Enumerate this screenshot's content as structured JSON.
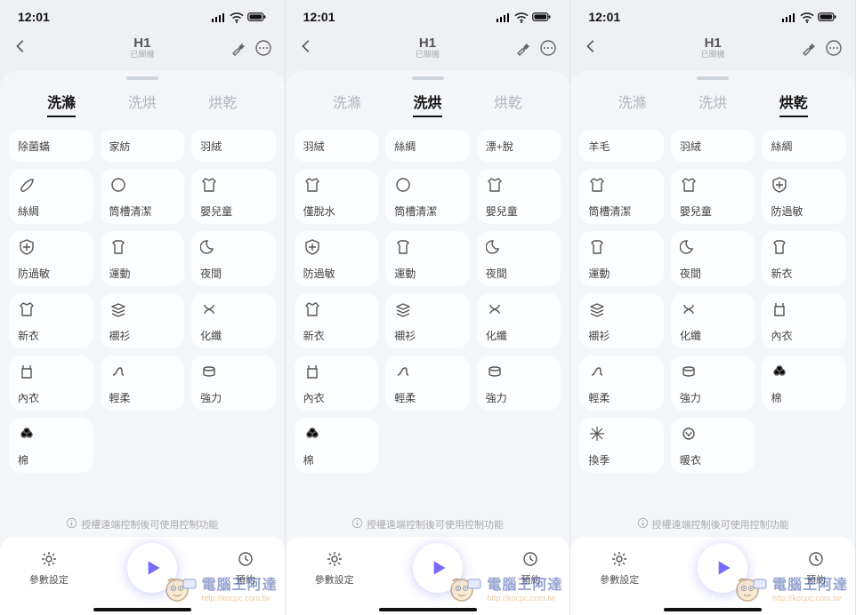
{
  "status": {
    "time": "12:01"
  },
  "header": {
    "title": "H1",
    "subtitle": "已關機"
  },
  "tabs": {
    "wash": "洗滌",
    "washDry": "洗烘",
    "dry": "烘乾"
  },
  "phone1": {
    "activeTab": 0,
    "row0": [
      "除菌蟎",
      "家紡",
      "羽絨"
    ],
    "opts": [
      {
        "icon": "silk",
        "label": "絲綢"
      },
      {
        "icon": "moon",
        "label": "筒槽清潔"
      },
      {
        "icon": "shirt",
        "label": "嬰兒童"
      },
      {
        "icon": "shield",
        "label": "防過敏"
      },
      {
        "icon": "tee",
        "label": "運動"
      },
      {
        "icon": "night",
        "label": "夜間"
      },
      {
        "icon": "shirt",
        "label": "新衣"
      },
      {
        "icon": "layers",
        "label": "襯衫"
      },
      {
        "icon": "fiber",
        "label": "化纖"
      },
      {
        "icon": "tank",
        "label": "內衣"
      },
      {
        "icon": "soft",
        "label": "輕柔"
      },
      {
        "icon": "strong",
        "label": "強力"
      },
      {
        "icon": "cotton",
        "label": "棉"
      }
    ]
  },
  "phone2": {
    "activeTab": 1,
    "row0": [
      "羽絨",
      "絲綢",
      "漂+脫"
    ],
    "opts": [
      {
        "icon": "shirt",
        "label": "僅脫水"
      },
      {
        "icon": "moon",
        "label": "筒槽清潔"
      },
      {
        "icon": "shirt",
        "label": "嬰兒童"
      },
      {
        "icon": "shield",
        "label": "防過敏"
      },
      {
        "icon": "tee",
        "label": "運動"
      },
      {
        "icon": "night",
        "label": "夜間"
      },
      {
        "icon": "shirt",
        "label": "新衣"
      },
      {
        "icon": "layers",
        "label": "襯衫"
      },
      {
        "icon": "fiber",
        "label": "化纖"
      },
      {
        "icon": "tank",
        "label": "內衣"
      },
      {
        "icon": "soft",
        "label": "輕柔"
      },
      {
        "icon": "strong",
        "label": "強力"
      },
      {
        "icon": "cotton",
        "label": "棉"
      }
    ]
  },
  "phone3": {
    "activeTab": 2,
    "row0": [
      "羊毛",
      "羽絨",
      "絲綢"
    ],
    "opts": [
      {
        "icon": "shirt",
        "label": "筒槽清潔"
      },
      {
        "icon": "shirt",
        "label": "嬰兒童"
      },
      {
        "icon": "shield",
        "label": "防過敏"
      },
      {
        "icon": "tee",
        "label": "運動"
      },
      {
        "icon": "night",
        "label": "夜間"
      },
      {
        "icon": "tee",
        "label": "新衣"
      },
      {
        "icon": "layers",
        "label": "襯衫"
      },
      {
        "icon": "fiber",
        "label": "化纖"
      },
      {
        "icon": "tank",
        "label": "內衣"
      },
      {
        "icon": "soft",
        "label": "輕柔"
      },
      {
        "icon": "strong",
        "label": "強力"
      },
      {
        "icon": "cotton",
        "label": "棉"
      },
      {
        "icon": "season",
        "label": "換季"
      },
      {
        "icon": "warm",
        "label": "暖衣"
      }
    ]
  },
  "footer": {
    "hint": "授權遠端控制後可使用控制功能",
    "left": "參數設定",
    "right": "預約"
  },
  "watermark": {
    "title": "電腦王阿達",
    "url": "http://kocpc.com.tw"
  }
}
